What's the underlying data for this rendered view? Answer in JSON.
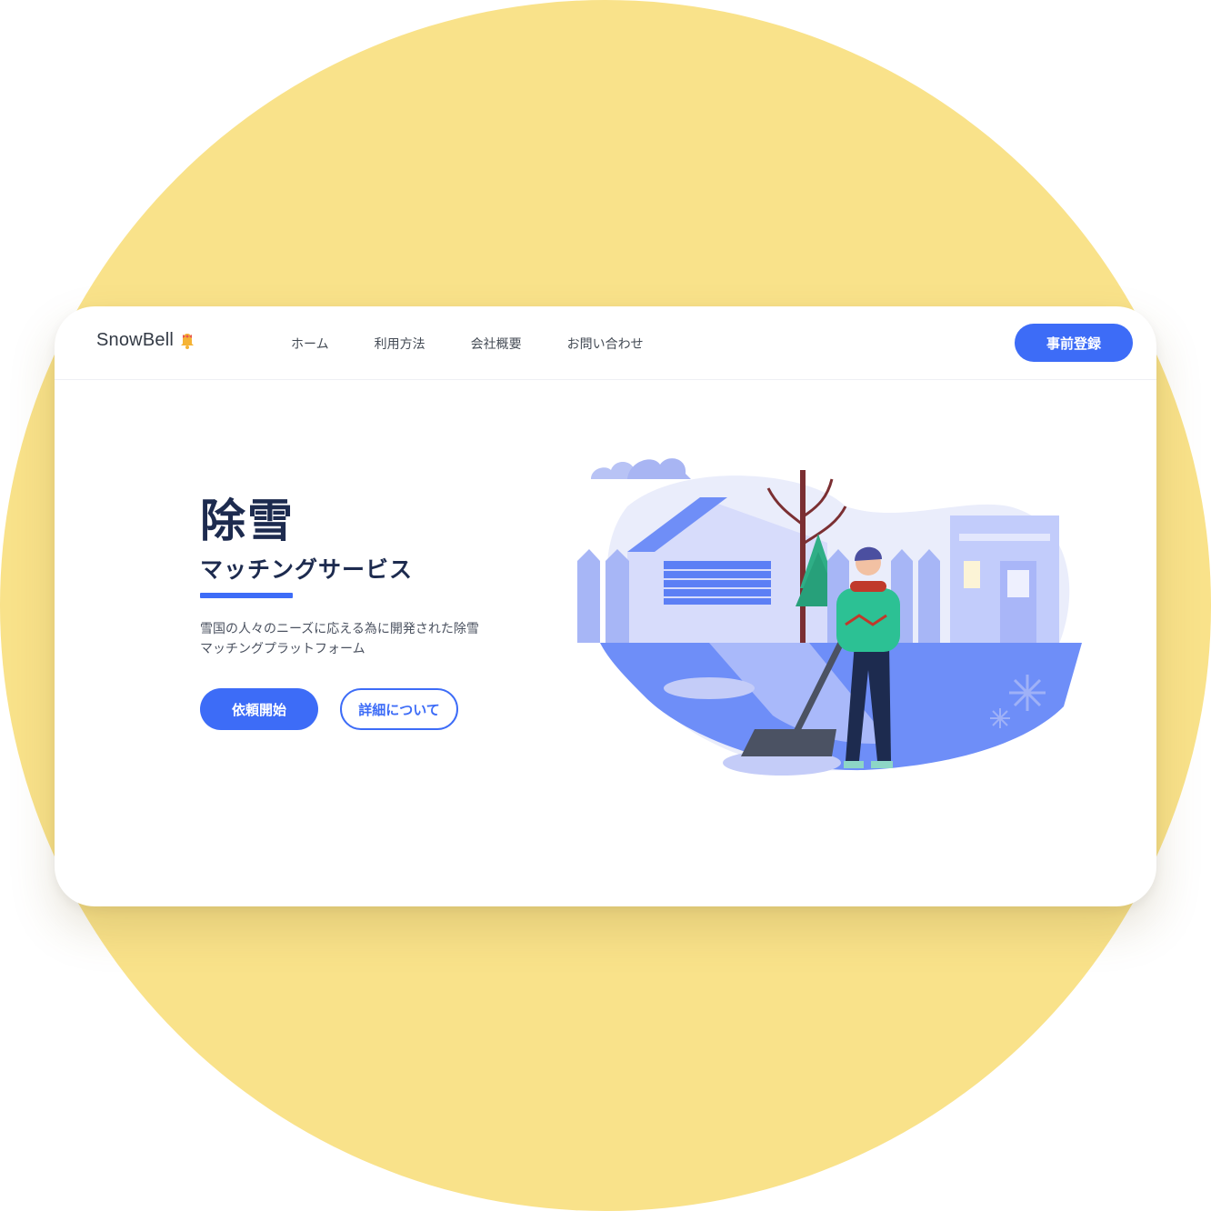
{
  "brand": {
    "name": "SnowBell",
    "icon": "bell-icon"
  },
  "nav": {
    "items": [
      {
        "label": "ホーム"
      },
      {
        "label": "利用方法"
      },
      {
        "label": "会社概要"
      },
      {
        "label": "お問い合わせ"
      }
    ],
    "cta_label": "事前登録"
  },
  "hero": {
    "title": "除雪",
    "subtitle": "マッチングサービス",
    "description_line1": "雪国の人々のニーズに応える為に開発された除雪",
    "description_line2": "マッチングプラットフォーム",
    "primary_button": "依頼開始",
    "secondary_button": "詳細について"
  },
  "colors": {
    "accent": "#3d6cf7",
    "background_circle": "#f9e28a",
    "heading": "#1d2b4f"
  },
  "illustration": {
    "icon": "snow-shoveling-illustration"
  }
}
